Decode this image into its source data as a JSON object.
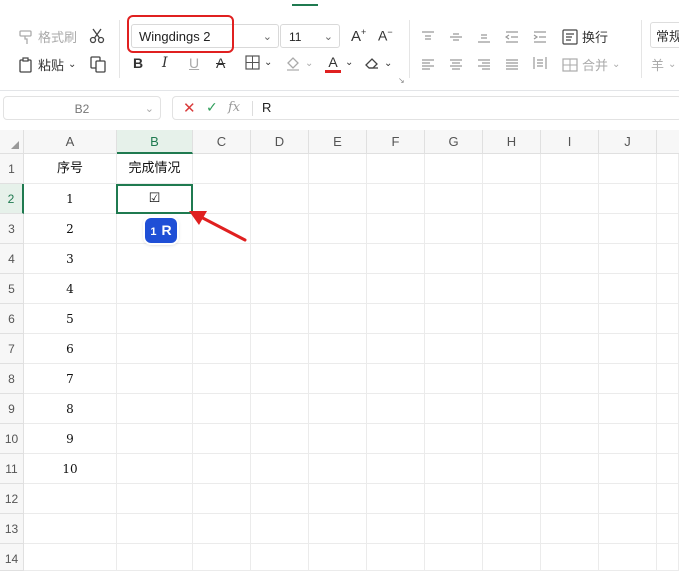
{
  "toolbar": {
    "format_painter": "格式刷",
    "paste": "粘贴",
    "font_name": "Wingdings 2",
    "font_size": "11",
    "wrap_text": "换行",
    "merge": "合并",
    "number_format": "常规",
    "currency_symbol": "羊"
  },
  "formula_bar": {
    "cell_ref": "B2",
    "value": "R",
    "fx": "fx"
  },
  "columns": [
    "A",
    "B",
    "C",
    "D",
    "E",
    "F",
    "G",
    "H",
    "I",
    "J"
  ],
  "rows": [
    "1",
    "2",
    "3",
    "4",
    "5",
    "6",
    "7",
    "8",
    "9",
    "10",
    "11",
    "12",
    "13",
    "14"
  ],
  "cells": {
    "A1": "序号",
    "B1": "完成情况",
    "B2": "☑",
    "A": [
      "1",
      "2",
      "3",
      "4",
      "5",
      "6",
      "7",
      "8",
      "9",
      "10"
    ]
  },
  "autocomplete_badge": {
    "num": "1",
    "text": "R"
  },
  "colors": {
    "accent": "#1f7a50",
    "highlight_box": "#e02020",
    "badge": "#1f4fd6"
  }
}
